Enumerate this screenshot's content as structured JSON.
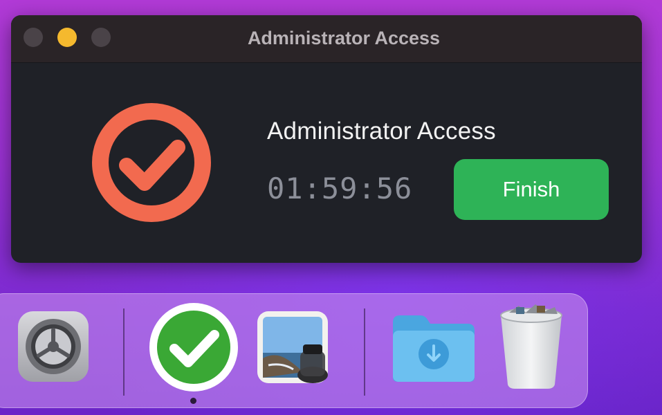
{
  "window": {
    "title": "Administrator Access",
    "heading": "Administrator Access",
    "timer": "01:59:56",
    "finish_label": "Finish"
  },
  "colors": {
    "accent_icon": "#f26a4f",
    "finish_button": "#2eb357",
    "window_bg": "#1f2127",
    "minimize": "#f5b92e"
  },
  "dock": {
    "apps": [
      {
        "icon": "system-preferences-gear-icon"
      },
      {
        "icon": "green-checkmark-app-icon",
        "running": true
      },
      {
        "icon": "preview-app-icon"
      },
      {
        "icon": "downloads-folder-icon"
      },
      {
        "icon": "trash-icon"
      }
    ]
  }
}
